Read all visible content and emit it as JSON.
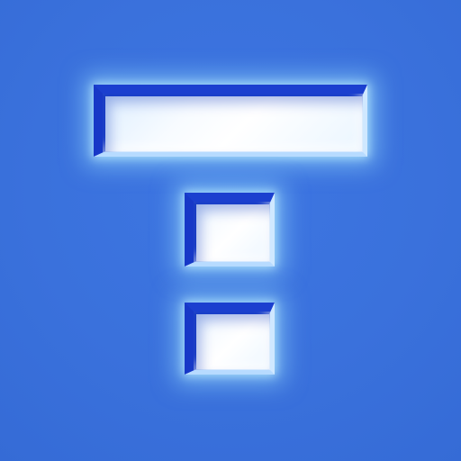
{
  "app_icon": {
    "name": "t-logo-icon",
    "colors": {
      "background": "#3A72DD",
      "glow": "#A0E6FF",
      "fill": "#F7FBFF",
      "bevel_dark": "#1B3FCF"
    }
  }
}
